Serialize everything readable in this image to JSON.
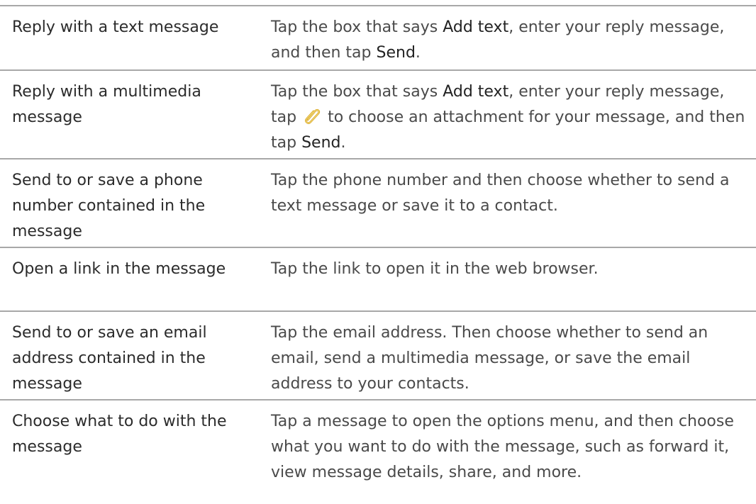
{
  "rows": [
    {
      "action": "Reply with a text message",
      "desc": {
        "t1": "Tap the box that says ",
        "b1": "Add text",
        "t2": ", enter your reply message, and then tap ",
        "b2": "Send",
        "t3": "."
      }
    },
    {
      "action": "Reply with a multimedia message",
      "desc": {
        "t1": "Tap the box that says ",
        "b1": "Add text",
        "t2": ", enter your reply message, tap ",
        "icon": "paperclip-icon",
        "t3": " to choose an attachment for your message, and then tap ",
        "b2": "Send",
        "t4": "."
      }
    },
    {
      "action": "Send to or save a phone number contained in the message",
      "desc": {
        "t1": "Tap the phone number and then choose whether to send a text message or save it to a contact."
      }
    },
    {
      "action": "Open a link in the message",
      "desc": {
        "t1": "Tap the link to open it in the web browser."
      }
    },
    {
      "action": "Send to or save an email address contained in the message",
      "desc": {
        "t1": "Tap the email address. Then choose whether to send an email, send a multimedia message, or save the email address to your contacts."
      }
    },
    {
      "action": "Choose what to do with the message",
      "desc": {
        "t1": "Tap a message to open the options menu, and then choose what you want to do with the message, such as forward it, view message details, share, and more."
      }
    }
  ],
  "colors": {
    "divider": "#a8a8a8",
    "text": "#2b2b2b",
    "icon": "#d4a017"
  }
}
